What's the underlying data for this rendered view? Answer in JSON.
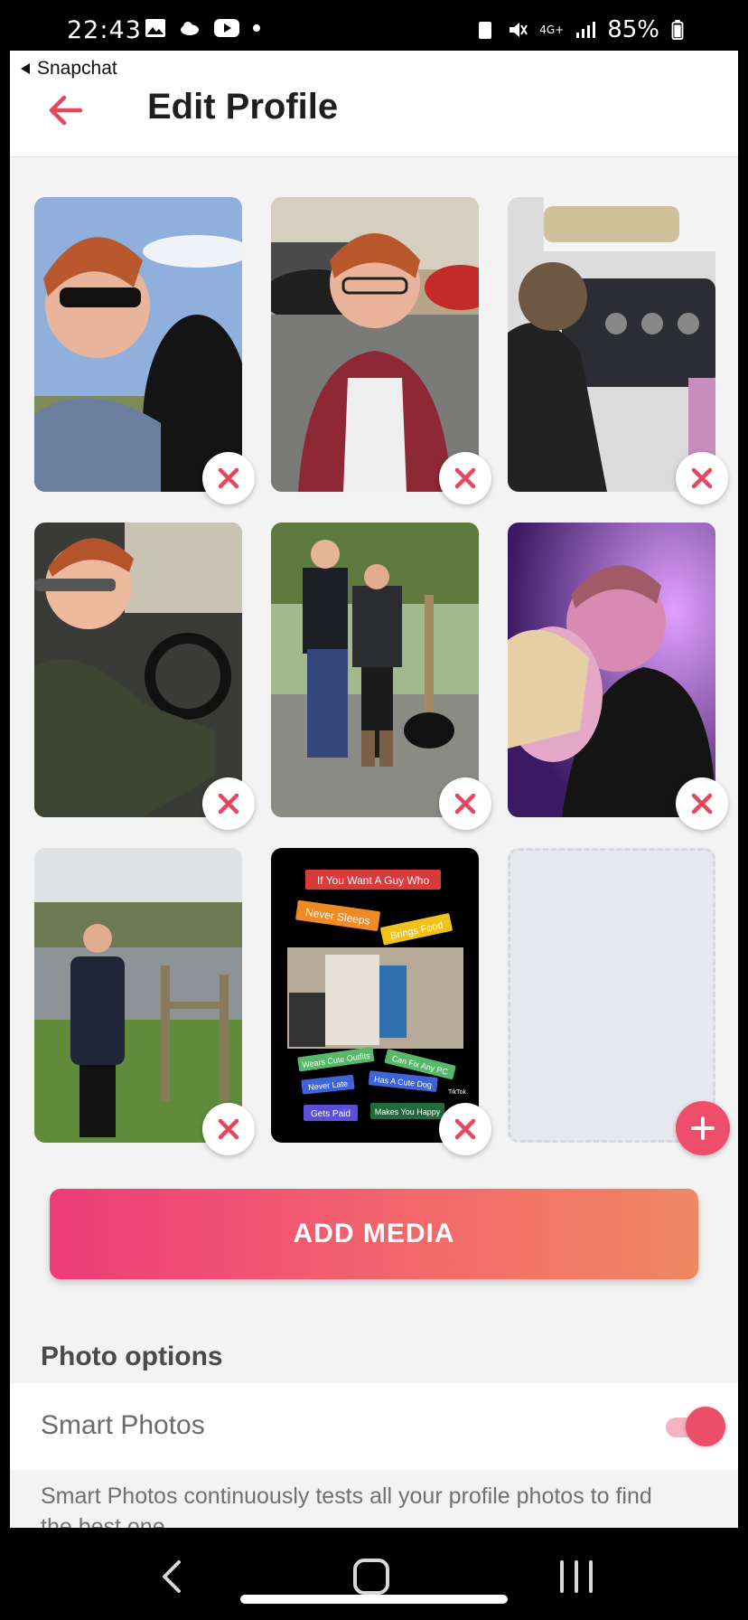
{
  "status_bar": {
    "time": "22:43",
    "battery": "85%",
    "network": "4G+"
  },
  "header": {
    "back_app_label": "Snapchat",
    "title": "Edit Profile"
  },
  "photos": [
    {
      "name": "photo-1",
      "description_icon": "photo-with-dog"
    },
    {
      "name": "photo-2",
      "description_icon": "photo-with-cars"
    },
    {
      "name": "photo-3",
      "description_icon": "photo-in-cockpit"
    },
    {
      "name": "photo-4",
      "description_icon": "photo-in-car"
    },
    {
      "name": "photo-5",
      "description_icon": "photo-couple-dog"
    },
    {
      "name": "photo-6",
      "description_icon": "photo-party"
    },
    {
      "name": "photo-7",
      "description_icon": "photo-by-lake"
    },
    {
      "name": "photo-8",
      "description_icon": "photo-meme"
    }
  ],
  "meme": {
    "top_line": "If You Want A Guy Who",
    "tag1": "Never Sleeps",
    "tag2": "Brings Food",
    "tag3": "Wears Cute Outfits",
    "tag4": "Can Fix Any PC",
    "tag5": "Never Late",
    "tag6": "Has A Cute Dog",
    "tag7": "Gets Paid",
    "tag8": "Makes You Happy",
    "watermark": "TikTok"
  },
  "add_media_label": "ADD MEDIA",
  "photo_options": {
    "section_title": "Photo options",
    "smart_photos_label": "Smart Photos",
    "smart_photos_enabled": true,
    "description": "Smart Photos continuously tests all your profile photos to find the best one."
  },
  "colors": {
    "accent": "#ec4d68",
    "remove_x": "#e8465e"
  }
}
